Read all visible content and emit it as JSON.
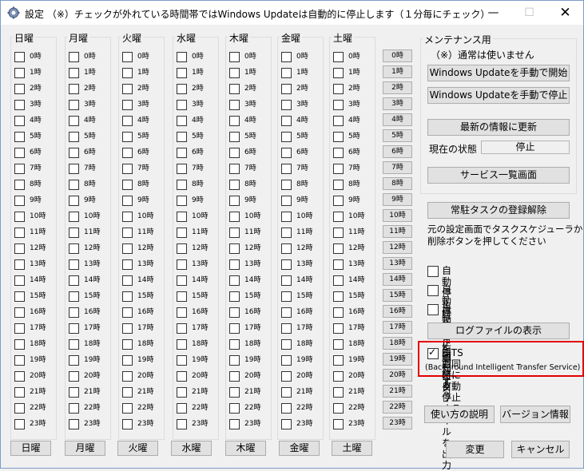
{
  "window": {
    "title": "設定 （※）チェックが外れている時間帯ではWindows Updateは自動的に停止します（１分毎にチェック）",
    "min_glyph": "—",
    "max_glyph": "☐",
    "close_glyph": "✕"
  },
  "days": [
    {
      "name": "日曜",
      "button": "日曜"
    },
    {
      "name": "月曜",
      "button": "月曜"
    },
    {
      "name": "火曜",
      "button": "火曜"
    },
    {
      "name": "水曜",
      "button": "水曜"
    },
    {
      "name": "木曜",
      "button": "木曜"
    },
    {
      "name": "金曜",
      "button": "金曜"
    },
    {
      "name": "土曜",
      "button": "土曜"
    }
  ],
  "hours": [
    "0時",
    "1時",
    "2時",
    "3時",
    "4時",
    "5時",
    "6時",
    "7時",
    "8時",
    "9時",
    "10時",
    "11時",
    "12時",
    "13時",
    "14時",
    "15時",
    "16時",
    "17時",
    "18時",
    "19時",
    "20時",
    "21時",
    "22時",
    "23時"
  ],
  "hour_buttons": [
    "0時",
    "1時",
    "2時",
    "3時",
    "4時",
    "5時",
    "6時",
    "7時",
    "8時",
    "9時",
    "10時",
    "11時",
    "12時",
    "13時",
    "14時",
    "15時",
    "16時",
    "17時",
    "18時",
    "19時",
    "20時",
    "21時",
    "22時",
    "23時"
  ],
  "maintenance": {
    "title": "メンテナンス用",
    "note": "（※）通常は使いません",
    "start_update": "Windows Updateを手動で開始",
    "stop_update": "Windows Updateを手動で停止",
    "refresh": "最新の情報に更新",
    "status_label": "現在の状態",
    "status_value": "停止",
    "service_list": "サービス一覧画面"
  },
  "unregister": {
    "button": "常駐タスクの登録解除",
    "desc_line1": "元の設定画面でタスクスケジューラから",
    "desc_line2": "削除ボタンを押してください"
  },
  "options": {
    "sound": {
      "label": "自動停止時に音を鳴らす",
      "checked": false
    },
    "notify": {
      "label": "自動停止時に通知する",
      "checked": false
    },
    "log": {
      "label": "自動停止時にログファイルを出力",
      "checked": false
    },
    "log_view": "ログファイルの表示",
    "bits": {
      "label": "BITSも同時に自動停止する",
      "checked": true
    },
    "bits_desc": "(Background Intelligent Transfer Service)"
  },
  "footer": {
    "help": "使い方の説明",
    "version": "バージョン情報",
    "apply": "変更",
    "cancel": "キャンセル"
  },
  "colors": {
    "highlight": "#e30000"
  }
}
